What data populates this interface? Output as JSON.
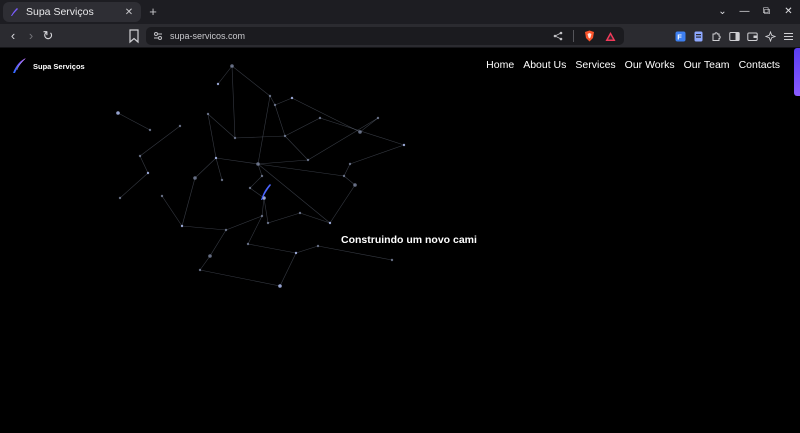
{
  "browser": {
    "tab": {
      "title": "Supa Serviços",
      "close_glyph": "✕"
    },
    "new_tab_glyph": "+",
    "window_controls": [
      "⌄",
      "—",
      "⧉",
      "✕"
    ],
    "url": "supa-servicos.com",
    "nav": {
      "back": "‹",
      "forward": "›",
      "reload": "↻"
    }
  },
  "site": {
    "logo_text": "Supa Serviços",
    "nav": [
      {
        "label": "Home"
      },
      {
        "label": "About Us"
      },
      {
        "label": "Services"
      },
      {
        "label": "Our Works"
      },
      {
        "label": "Our Team"
      },
      {
        "label": "Contacts"
      }
    ],
    "hero_text": "Construindo um novo cami"
  },
  "colors": {
    "brand_accent": "#6b4cff",
    "page_background": "#000000",
    "browser_chrome": "#2b2b30",
    "brave_shield": "#fb542b"
  }
}
